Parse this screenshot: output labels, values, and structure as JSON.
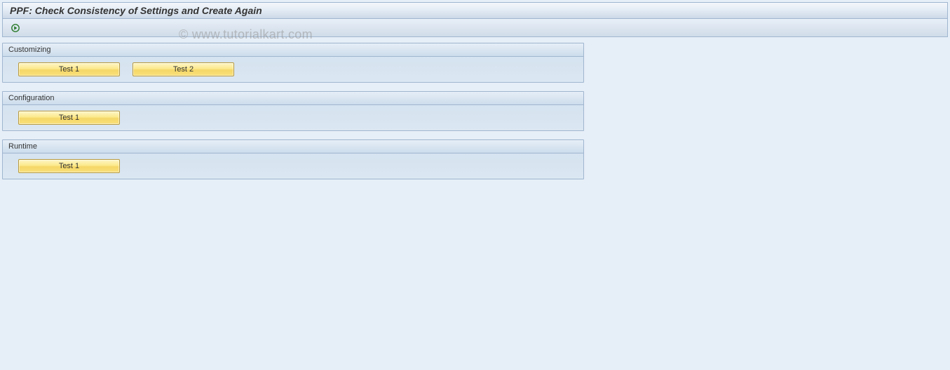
{
  "header": {
    "title": "PPF: Check Consistency of Settings and Create Again"
  },
  "toolbar": {
    "execute_icon_name": "execute-icon"
  },
  "groups": [
    {
      "title": "Customizing",
      "buttons": [
        {
          "label": "Test 1"
        },
        {
          "label": "Test 2"
        }
      ]
    },
    {
      "title": "Configuration",
      "buttons": [
        {
          "label": "Test 1"
        }
      ]
    },
    {
      "title": "Runtime",
      "buttons": [
        {
          "label": "Test 1"
        }
      ]
    }
  ],
  "watermark": "© www.tutorialkart.com"
}
